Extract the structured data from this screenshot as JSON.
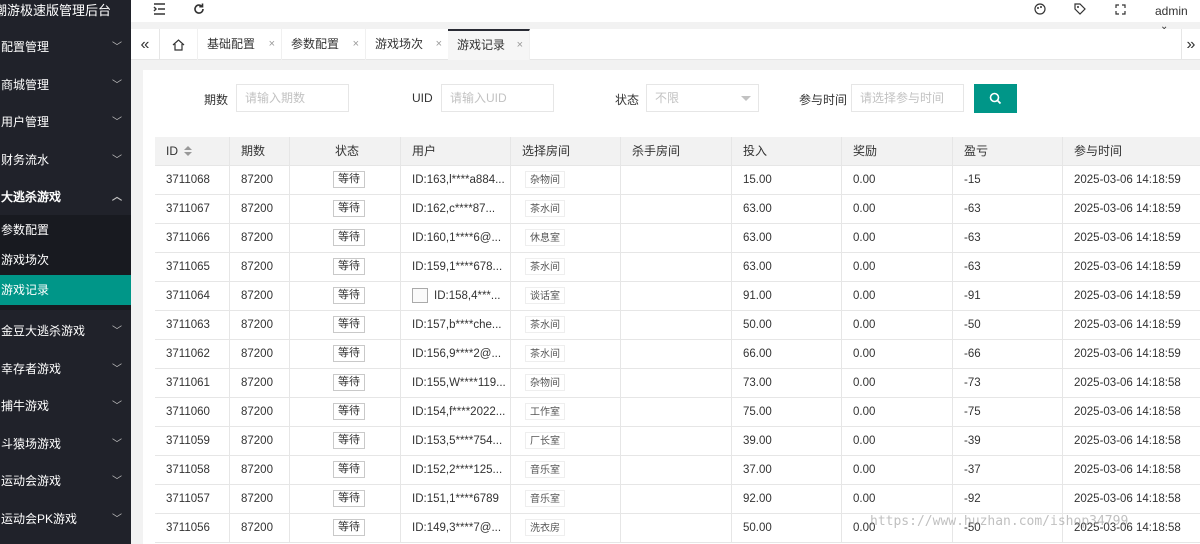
{
  "app": {
    "title": "潮游极速版管理后台"
  },
  "sidebar": {
    "items": [
      {
        "label": "配置管理",
        "chevron": "down"
      },
      {
        "label": "商城管理",
        "chevron": "down"
      },
      {
        "label": "用户管理",
        "chevron": "down"
      },
      {
        "label": "财务流水",
        "chevron": "down"
      },
      {
        "label": "大逃杀游戏",
        "chevron": "up"
      },
      {
        "label": "金豆大逃杀游戏",
        "chevron": "down"
      },
      {
        "label": "幸存者游戏",
        "chevron": "down"
      },
      {
        "label": "捕牛游戏",
        "chevron": "down"
      },
      {
        "label": "斗猿场游戏",
        "chevron": "down"
      },
      {
        "label": "运动会游戏",
        "chevron": "down"
      },
      {
        "label": "运动会PK游戏",
        "chevron": "down"
      }
    ],
    "subitems": [
      {
        "label": "参数配置"
      },
      {
        "label": "游戏场次"
      },
      {
        "label": "游戏记录",
        "active": true
      }
    ]
  },
  "header": {
    "user": "admin",
    "icons": [
      "menu-toggle-icon",
      "refresh-icon",
      "theme-icon",
      "tag-icon",
      "fullscreen-icon",
      "chevron-down-icon"
    ]
  },
  "tabs": {
    "items": [
      {
        "label": "基础配置"
      },
      {
        "label": "参数配置"
      },
      {
        "label": "游戏场次"
      },
      {
        "label": "游戏记录",
        "active": true
      }
    ],
    "close_glyph": "×"
  },
  "filters": {
    "period": {
      "label": "期数",
      "placeholder": "请输入期数"
    },
    "uid": {
      "label": "UID",
      "placeholder": "请输入UID"
    },
    "status": {
      "label": "状态",
      "value": "不限"
    },
    "time": {
      "label": "参与时间",
      "placeholder": "请选择参与时间"
    }
  },
  "table": {
    "columns": [
      "ID",
      "期数",
      "状态",
      "用户",
      "选择房间",
      "杀手房间",
      "投入",
      "奖励",
      "盈亏",
      "参与时间"
    ],
    "rows": [
      {
        "id": "3711068",
        "period": "87200",
        "status": "等待",
        "user": "ID:163,l****a884...",
        "room": "杂物间",
        "killer": "",
        "bet": "15.00",
        "reward": "0.00",
        "pnl": "-15",
        "time": "2025-03-06 14:18:59",
        "img": false
      },
      {
        "id": "3711067",
        "period": "87200",
        "status": "等待",
        "user": "ID:162,c****87...",
        "room": "茶水间",
        "killer": "",
        "bet": "63.00",
        "reward": "0.00",
        "pnl": "-63",
        "time": "2025-03-06 14:18:59",
        "img": false
      },
      {
        "id": "3711066",
        "period": "87200",
        "status": "等待",
        "user": "ID:160,1****6@...",
        "room": "休息室",
        "killer": "",
        "bet": "63.00",
        "reward": "0.00",
        "pnl": "-63",
        "time": "2025-03-06 14:18:59",
        "img": false
      },
      {
        "id": "3711065",
        "period": "87200",
        "status": "等待",
        "user": "ID:159,1****678...",
        "room": "茶水间",
        "killer": "",
        "bet": "63.00",
        "reward": "0.00",
        "pnl": "-63",
        "time": "2025-03-06 14:18:59",
        "img": false
      },
      {
        "id": "3711064",
        "period": "87200",
        "status": "等待",
        "user": "ID:158,4***...",
        "room": "谈话室",
        "killer": "",
        "bet": "91.00",
        "reward": "0.00",
        "pnl": "-91",
        "time": "2025-03-06 14:18:59",
        "img": true
      },
      {
        "id": "3711063",
        "period": "87200",
        "status": "等待",
        "user": "ID:157,b****che...",
        "room": "茶水间",
        "killer": "",
        "bet": "50.00",
        "reward": "0.00",
        "pnl": "-50",
        "time": "2025-03-06 14:18:59",
        "img": false
      },
      {
        "id": "3711062",
        "period": "87200",
        "status": "等待",
        "user": "ID:156,9****2@...",
        "room": "茶水间",
        "killer": "",
        "bet": "66.00",
        "reward": "0.00",
        "pnl": "-66",
        "time": "2025-03-06 14:18:59",
        "img": false
      },
      {
        "id": "3711061",
        "period": "87200",
        "status": "等待",
        "user": "ID:155,W****119...",
        "room": "杂物间",
        "killer": "",
        "bet": "73.00",
        "reward": "0.00",
        "pnl": "-73",
        "time": "2025-03-06 14:18:58",
        "img": false
      },
      {
        "id": "3711060",
        "period": "87200",
        "status": "等待",
        "user": "ID:154,f****2022...",
        "room": "工作室",
        "killer": "",
        "bet": "75.00",
        "reward": "0.00",
        "pnl": "-75",
        "time": "2025-03-06 14:18:58",
        "img": false
      },
      {
        "id": "3711059",
        "period": "87200",
        "status": "等待",
        "user": "ID:153,5****754...",
        "room": "厂长室",
        "killer": "",
        "bet": "39.00",
        "reward": "0.00",
        "pnl": "-39",
        "time": "2025-03-06 14:18:58",
        "img": false
      },
      {
        "id": "3711058",
        "period": "87200",
        "status": "等待",
        "user": "ID:152,2****125...",
        "room": "音乐室",
        "killer": "",
        "bet": "37.00",
        "reward": "0.00",
        "pnl": "-37",
        "time": "2025-03-06 14:18:58",
        "img": false
      },
      {
        "id": "3711057",
        "period": "87200",
        "status": "等待",
        "user": "ID:151,1****6789",
        "room": "音乐室",
        "killer": "",
        "bet": "92.00",
        "reward": "0.00",
        "pnl": "-92",
        "time": "2025-03-06 14:18:58",
        "img": false
      },
      {
        "id": "3711056",
        "period": "87200",
        "status": "等待",
        "user": "ID:149,3****7@...",
        "room": "洗衣房",
        "killer": "",
        "bet": "50.00",
        "reward": "0.00",
        "pnl": "-50",
        "time": "2025-03-06 14:18:58",
        "img": false
      }
    ]
  },
  "watermark": "https://www.huzhan.com/ishop34799",
  "colors": {
    "sidebar_bg": "#20222a",
    "accent": "#009688"
  }
}
